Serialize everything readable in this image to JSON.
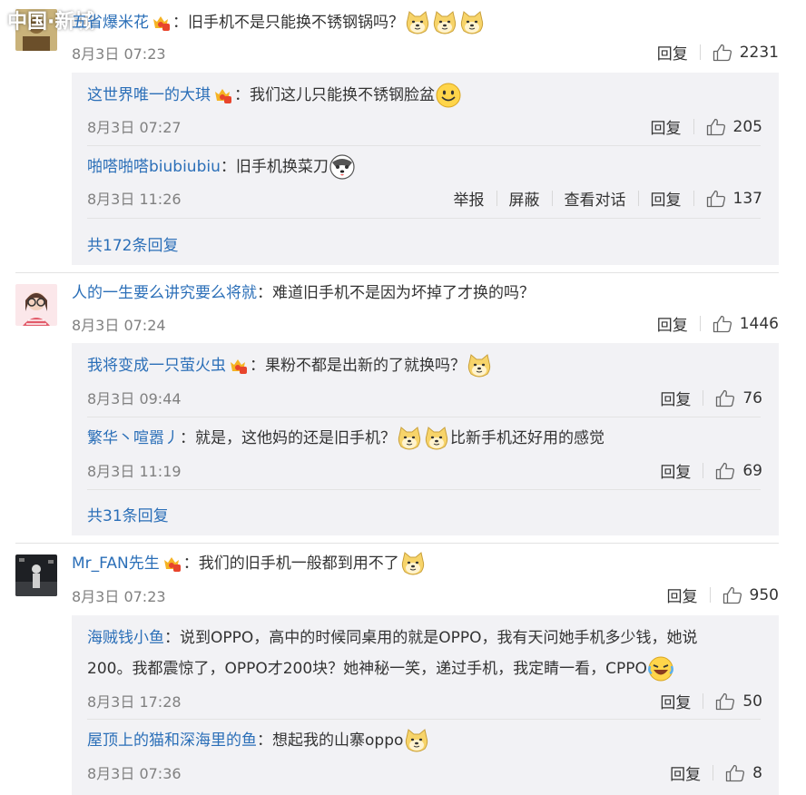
{
  "watermark": "中国·新城",
  "c1": {
    "user": "五省爆米花",
    "text": "：旧手机不是只能换不锈钢锅吗？",
    "time": "8月3日 07:23",
    "reply": "回复",
    "likes": "2231",
    "replies": [
      {
        "user": "这世界唯一的大琪",
        "text": "：我们这儿只能换不锈钢脸盆",
        "time": "8月3日 07:27",
        "reply": "回复",
        "likes": "205"
      },
      {
        "user": "啪嗒啪嗒biubiubiu",
        "text": "：旧手机换菜刀",
        "time": "8月3日 11:26",
        "report": "举报",
        "block": "屏蔽",
        "view": "查看对话",
        "reply": "回复",
        "likes": "137"
      }
    ],
    "more": "共172条回复"
  },
  "c2": {
    "user": "人的一生要么讲究要么将就",
    "text": "：难道旧手机不是因为坏掉了才换的吗？",
    "time": "8月3日 07:24",
    "reply": "回复",
    "likes": "1446",
    "replies": [
      {
        "user": "我将变成一只萤火虫",
        "text": "：果粉不都是出新的了就换吗？",
        "time": "8月3日 09:44",
        "reply": "回复",
        "likes": "76"
      },
      {
        "user": "繁华丶喧嚣丿",
        "text": "：就是，这他妈的还是旧手机？",
        "text2": "比新手机还好用的感觉",
        "time": "8月3日 11:19",
        "reply": "回复",
        "likes": "69"
      }
    ],
    "more": "共31条回复"
  },
  "c3": {
    "user": "Mr_FAN先生",
    "text": "：我们的旧手机一般都到用不了",
    "time": "8月3日 07:23",
    "reply": "回复",
    "likes": "950",
    "replies": [
      {
        "user": "海贼钱小鱼",
        "text": "：说到OPPO，高中的时候同桌用的就是OPPO，我有天问她手机多少钱，她说",
        "text2": "200。我都震惊了，OPPO才200块？她神秘一笑，递过手机，我定睛一看，CPPO",
        "time": "8月3日 17:28",
        "reply": "回复",
        "likes": "50"
      },
      {
        "user": "屋顶上的猫和深海里的鱼",
        "text": "：想起我的山寨oppo",
        "time": "8月3日 07:36",
        "reply": "回复",
        "likes": "8"
      }
    ]
  }
}
